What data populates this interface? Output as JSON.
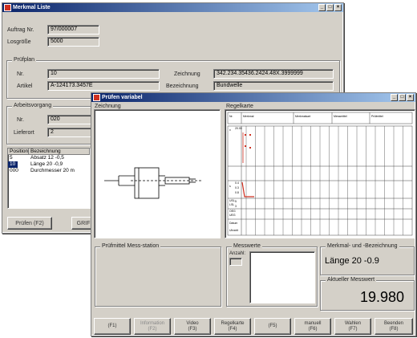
{
  "back_window": {
    "title": "Merkmal Liste",
    "auftrag_label": "Auftrag Nr.",
    "auftrag_value": "97/000007",
    "losgroesse_label": "Losgröße",
    "losgroesse_value": "5000",
    "pruefplan_group": "Prüfplan",
    "nr_label": "Nr.",
    "nr_value": "10",
    "artikel_label": "Artikel",
    "artikel_value": "A-124173.3457E",
    "zeichnung_label": "Zeichnung",
    "zeichnung_value": "342.234.35436.2424.48X.3999999",
    "bezeichnung_label": "Bezeichnung",
    "bezeichnung_value": "Bundwelle",
    "arbeitsvorgang_group": "Arbeitsvorgang",
    "av_nr_label": "Nr.",
    "av_nr_value": "020",
    "lieferort_label": "Lieferort",
    "lieferort_value": "2",
    "list_headers": [
      "Position",
      "Bezeichnung"
    ],
    "list_rows": [
      {
        "pos": "5",
        "bez": "Absatz 12 -0,5"
      },
      {
        "pos": "10",
        "bez": "Länge 20 -0,9"
      },
      {
        "pos": "000",
        "bez": "Durchmesser 20 m"
      }
    ],
    "pruefen_button": "Prüfen (F2)",
    "grafik_button": "GRIF"
  },
  "front_window": {
    "title": "Prüfen variabel",
    "zeichnung_group": "Zeichnung",
    "regelkarte_group": "Regelkarte",
    "chart_headers": [
      "Nr.",
      "Merkmal",
      "Merkmalsart",
      "Messmittel",
      "Prüfmittel"
    ],
    "row_labels": [
      "x",
      "s",
      "USL",
      "LSL",
      "OEG",
      "UEG",
      "Datum",
      "Uhrzeit"
    ],
    "left_numbers": [
      "20.00",
      "0.4",
      "0.3",
      "0.8",
      "5",
      "3"
    ],
    "pruefmittel_group": "Prüfmittel Mess-station",
    "messwert_group": "Messwerte",
    "anzahl_label": "Anzahl:",
    "merkmal_group": "Merkmal- und -Bezeichnung",
    "merkmal_value": "Länge 20 -0.9",
    "aktueller_group": "Aktueller Messwert",
    "aktueller_value": "19.980",
    "buttons": [
      {
        "line1": "",
        "line2": "(F1)"
      },
      {
        "line1": "Information",
        "line2": "(F2)"
      },
      {
        "line1": "Video",
        "line2": "(F3)"
      },
      {
        "line1": "Regelkarte",
        "line2": "(F4)"
      },
      {
        "line1": "",
        "line2": "(F5)"
      },
      {
        "line1": "manuell",
        "line2": "(F6)"
      },
      {
        "line1": "Wahlen",
        "line2": "(F7)"
      },
      {
        "line1": "Beenden",
        "line2": "(F8)"
      }
    ]
  },
  "colors": {
    "title_active": "#0a246a",
    "chart_line": "#d03020",
    "face": "#d4d0c8"
  }
}
